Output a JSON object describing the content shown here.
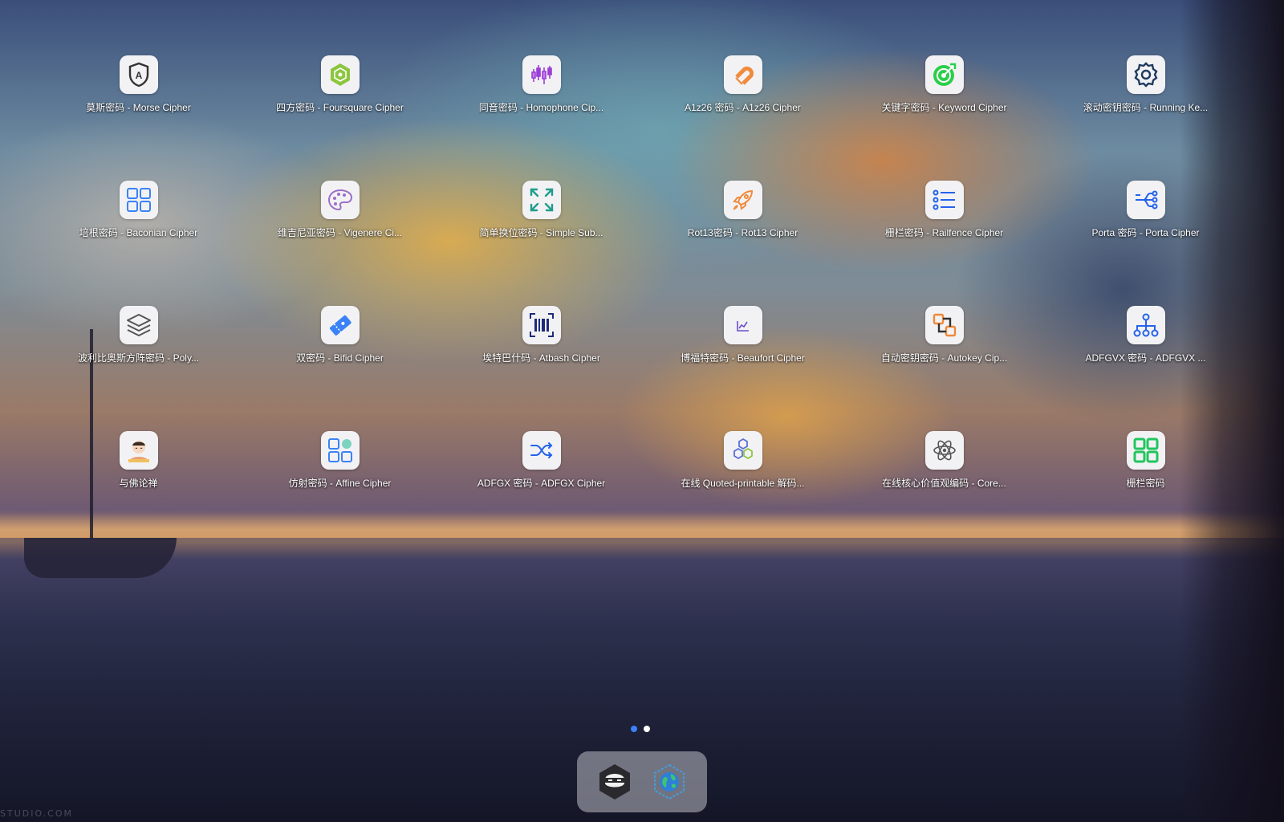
{
  "apps": [
    {
      "label": "莫斯密码 - Morse Cipher",
      "icon": "shield-a-icon",
      "color": "#333333"
    },
    {
      "label": "四方密码 - Foursquare Cipher",
      "icon": "cube-icon",
      "color": "#8cc63f"
    },
    {
      "label": "同音密码 - Homophone Cip...",
      "icon": "candlestick-icon",
      "color": "#9b3fd6"
    },
    {
      "label": "A1z26 密码 - A1z26 Cipher",
      "icon": "magnet-icon",
      "color": "#f08a3c"
    },
    {
      "label": "关键字密码 - Keyword Cipher",
      "icon": "target-icon",
      "color": "#2bcf4a"
    },
    {
      "label": "滚动密钥密码 - Running Ke...",
      "icon": "gear-icon",
      "color": "#1e3a5f"
    },
    {
      "label": "培根密码 - Baconian Cipher",
      "icon": "grid-icon",
      "color": "#3b82f6"
    },
    {
      "label": "维吉尼亚密码 - Vigenere Ci...",
      "icon": "palette-icon",
      "color": "#9b6fc6"
    },
    {
      "label": "简单换位密码 - Simple Sub...",
      "icon": "expand-icon",
      "color": "#1f9e8a"
    },
    {
      "label": "Rot13密码 - Rot13 Cipher",
      "icon": "rocket-icon",
      "color": "#f08a3c"
    },
    {
      "label": "栅栏密码 - Railfence Cipher",
      "icon": "list-icon",
      "color": "#2563eb"
    },
    {
      "label": "Porta 密码 - Porta Cipher",
      "icon": "circuit-icon",
      "color": "#2563eb"
    },
    {
      "label": "波利比奥斯方阵密码 - Poly...",
      "icon": "layers-icon",
      "color": "#555555"
    },
    {
      "label": "双密码 - Bifid Cipher",
      "icon": "ticket-icon",
      "color": "#3b82f6"
    },
    {
      "label": "埃特巴什码 - Atbash Cipher",
      "icon": "barcode-icon",
      "color": "#1e2a78"
    },
    {
      "label": "博福特密码 - Beaufort Cipher",
      "icon": "chart-icon",
      "color": "#6d4fc6"
    },
    {
      "label": "自动密钥密码 - Autokey Cip...",
      "icon": "connect-icon",
      "color": "#f08a3c"
    },
    {
      "label": "ADFGVX 密码 - ADFGVX ...",
      "icon": "hierarchy-icon",
      "color": "#2563eb"
    },
    {
      "label": "与佛论禅",
      "icon": "monk-icon",
      "color": "#e8a070"
    },
    {
      "label": "仿射密码 - Affine Cipher",
      "icon": "blocks-icon",
      "color": "#3b82f6"
    },
    {
      "label": "ADFGX 密码 - ADFGX Cipher",
      "icon": "shuffle-icon",
      "color": "#2563eb"
    },
    {
      "label": "在线 Quoted-printable 解码...",
      "icon": "hexagons-icon",
      "color": "#5a6fd6"
    },
    {
      "label": "在线核心价值观编码 - Core...",
      "icon": "atom-icon",
      "color": "#555555"
    },
    {
      "label": "栅栏密码",
      "icon": "four-squares-icon",
      "color": "#22c55e"
    }
  ],
  "pager": {
    "pages": 2,
    "active": 1
  },
  "dock": [
    {
      "icon": "ninja-hex-icon"
    },
    {
      "icon": "globe-cube-icon"
    }
  ],
  "watermark": "STUDIO.COM"
}
